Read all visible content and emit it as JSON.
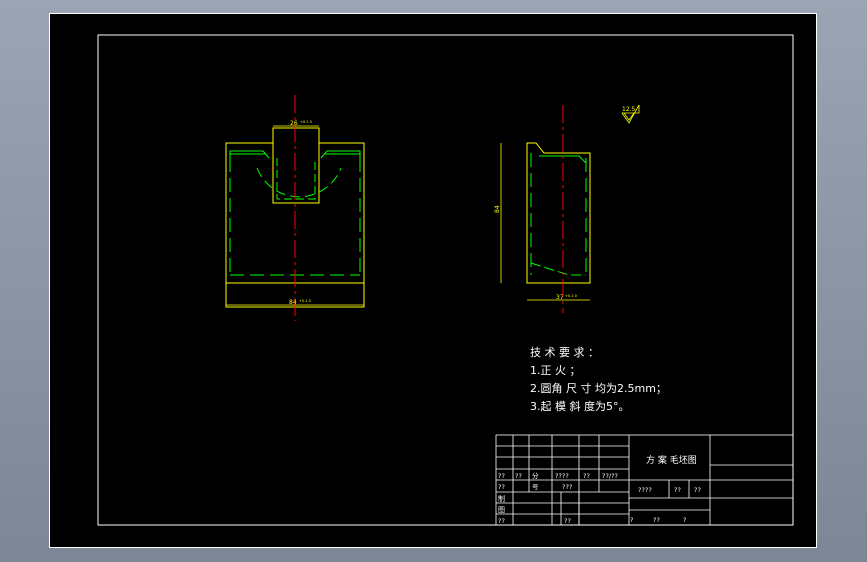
{
  "dims": {
    "top_width": "26",
    "top_width_tol": "+0.1 0",
    "bottom_width": "84",
    "bottom_width_tol": "+0.1 0",
    "height": "84",
    "side_width": "37",
    "side_width_tol": "+0.1 0"
  },
  "roughness": "12.5",
  "tech_requirements": {
    "title": "技 术 要 求 ：",
    "item1": "1.正 火 ；",
    "item2": "2.圆角 尺 寸 均为2.5mm；",
    "item3": "3.起 模 斜 度为5°。"
  },
  "title_block": {
    "drawing_name": "方 案 毛坯图",
    "row1": [
      "??",
      "??",
      "分",
      "????",
      "??",
      "??/??"
    ],
    "row2": [
      "??",
      "号",
      "???"
    ],
    "cells": [
      "????",
      "??",
      "??"
    ],
    "labels": [
      "制",
      "图",
      "??",
      "??"
    ],
    "bottom": [
      "?",
      "??",
      "?"
    ]
  },
  "colors": {
    "border": "#ffffff",
    "outline": "#ffff00",
    "hidden": "#00ff00",
    "center": "#ff0000",
    "text": "#ffffff"
  }
}
